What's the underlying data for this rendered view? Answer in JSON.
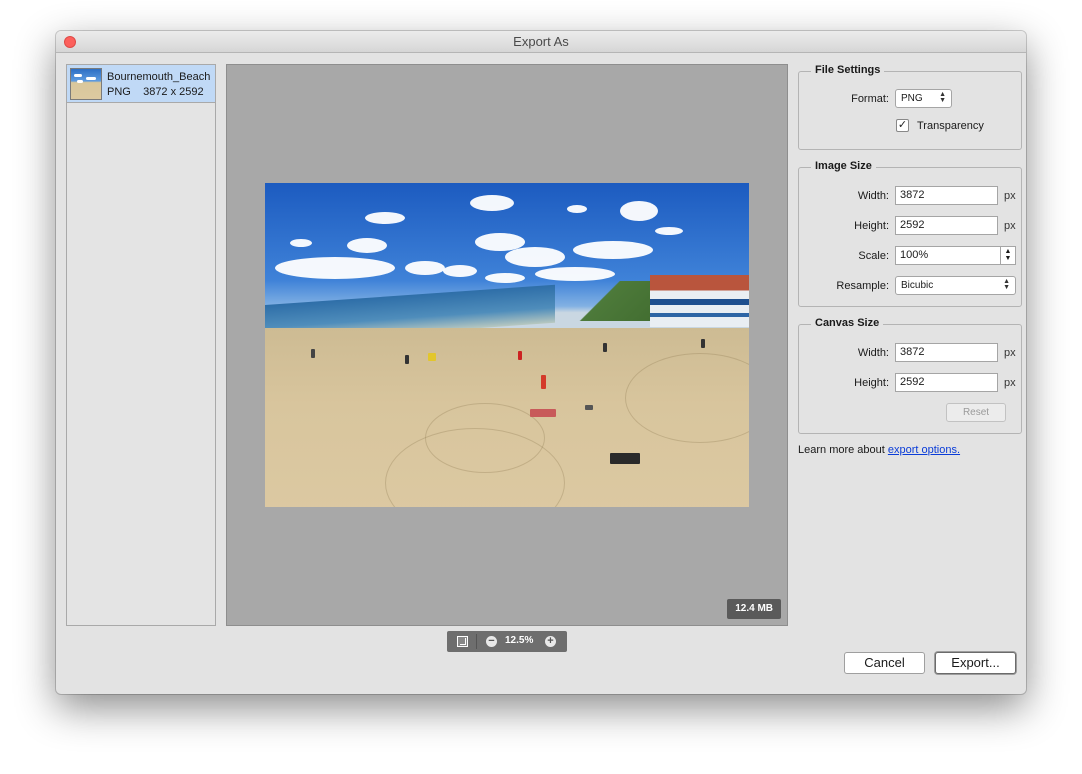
{
  "window": {
    "title": "Export As"
  },
  "file_list": {
    "items": [
      {
        "name": "Bournemouth_Beach",
        "format": "PNG",
        "dimensions": "3872 x 2592"
      }
    ]
  },
  "preview": {
    "file_size": "12.4 MB",
    "zoom": "12.5%"
  },
  "file_settings": {
    "title": "File Settings",
    "format_label": "Format:",
    "format_value": "PNG",
    "transparency_label": "Transparency",
    "transparency_checked": true
  },
  "image_size": {
    "title": "Image Size",
    "width_label": "Width:",
    "width_value": "3872",
    "height_label": "Height:",
    "height_value": "2592",
    "scale_label": "Scale:",
    "scale_value": "100%",
    "resample_label": "Resample:",
    "resample_value": "Bicubic",
    "unit": "px"
  },
  "canvas_size": {
    "title": "Canvas Size",
    "width_label": "Width:",
    "width_value": "3872",
    "height_label": "Height:",
    "height_value": "2592",
    "unit": "px",
    "reset_label": "Reset"
  },
  "learn_more": {
    "prefix": "Learn more about ",
    "link": "export options."
  },
  "buttons": {
    "cancel": "Cancel",
    "export": "Export..."
  }
}
